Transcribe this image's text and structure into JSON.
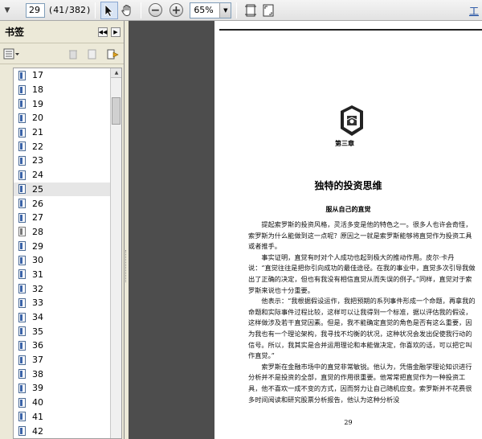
{
  "toolbar": {
    "current_page": "29",
    "page_position": "41",
    "page_separator": "/",
    "page_total": "382",
    "zoom": "65%",
    "tools_label": "工"
  },
  "panel": {
    "title": "书签",
    "bookmarks": [
      "17",
      "18",
      "19",
      "20",
      "21",
      "22",
      "23",
      "24",
      "25",
      "26",
      "27",
      "28",
      "29",
      "30",
      "31",
      "32",
      "33",
      "34",
      "35",
      "36",
      "37",
      "38",
      "39",
      "40",
      "41",
      "42"
    ],
    "selected": "25"
  },
  "page": {
    "chapter": "第三章",
    "title": "独特的投资思维",
    "section": "服从自己的直觉",
    "paragraphs": [
      "提起索罗斯的投资风格，灵活多变是他的特色之一。很多人也许会奇怪，索罗斯为什么能做到这一点呢？原因之一就是索罗斯能够将直觉作为投资工具或者推手。",
      "事实证明，直觉有时对个人成功也起到极大的推动作用。皮尔·卡丹说：“直觉往往是把你引向成功的最佳途径。在我的事业中，直觉多次引导我做出了正确的决定，但也有我没有相信直觉从而失误的例子。”同样，直觉对于索罗斯来说也十分重要。",
      "他表示：“我根据假设运作，我把预期的系列事件形成一个命题，再拿我的命题和实际事件过程比较，这样可以让我得到一个标准，据以评估我的假设，这样做涉及若干直觉因素。但是，我不能确定直觉的角色是否有这么重要，因为我也有一个理论架构，我寻找不均衡的状况，这种状况会发出促使我行动的信号。所以，我其实是合并运用理论和本能做决定，你喜欢的话，可以把它叫作直觉。”",
      "索罗斯在金融市场中的直觉非常敏锐。他认为，凭借金融学理论知识进行分析并不是投资的全部，直觉的作用很重要。他常常把直觉作为一种投资工具，他不喜欢一成不变的方式，因而努力让自己随机应变。索罗斯并不花费很多时间阅读和研究股票分析报告，他认为这种分析没"
    ],
    "page_number": "29"
  },
  "colors": {
    "doc_background": "#4d4d4d",
    "panel_background": "#ece9d8",
    "bookmark_icon": "#3a63a8",
    "link": "#1a4aa0"
  }
}
